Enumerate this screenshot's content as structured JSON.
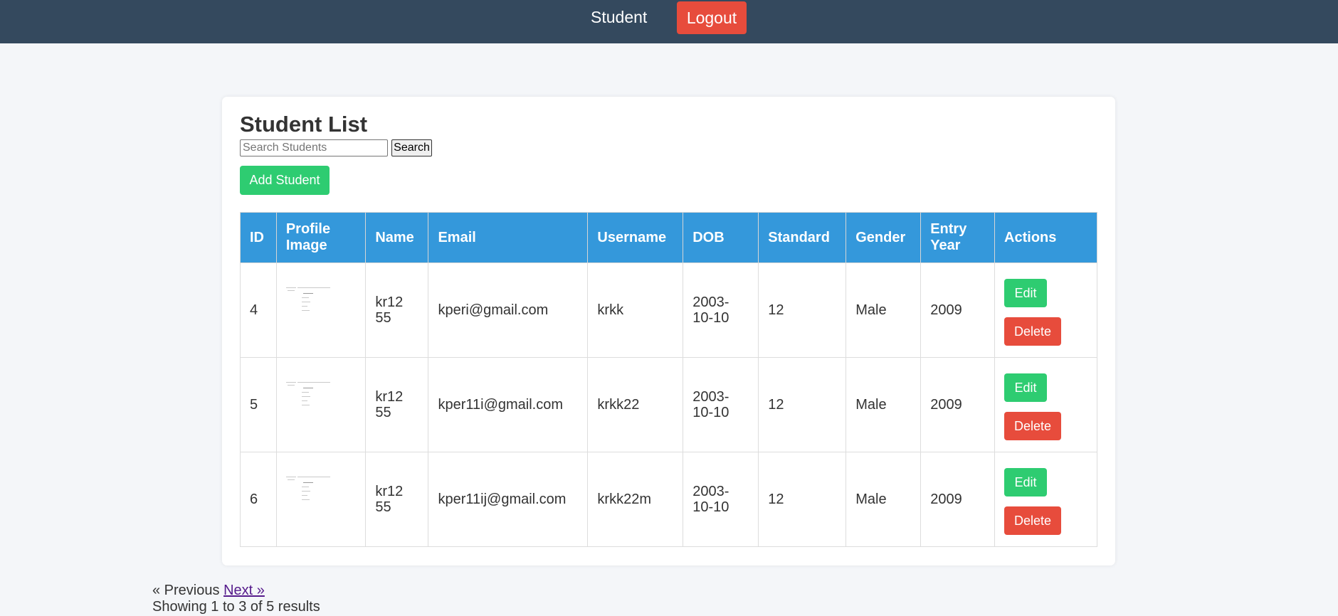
{
  "nav": {
    "student_link": "Student",
    "logout_label": "Logout"
  },
  "page": {
    "title": "Student List",
    "search_placeholder": "Search Students",
    "search_button": "Search",
    "add_button": "Add Student"
  },
  "table": {
    "headers": [
      "ID",
      "Profile Image",
      "Name",
      "Email",
      "Username",
      "DOB",
      "Standard",
      "Gender",
      "Entry Year",
      "Actions"
    ],
    "rows": [
      {
        "id": "4",
        "name": "kr12 55",
        "email": "kperi@gmail.com",
        "username": "krkk",
        "dob": "2003-10-10",
        "standard": "12",
        "gender": "Male",
        "entry_year": "2009",
        "edit": "Edit",
        "delete": "Delete"
      },
      {
        "id": "5",
        "name": "kr12 55",
        "email": "kper11i@gmail.com",
        "username": "krkk22",
        "dob": "2003-10-10",
        "standard": "12",
        "gender": "Male",
        "entry_year": "2009",
        "edit": "Edit",
        "delete": "Delete"
      },
      {
        "id": "6",
        "name": "kr12 55",
        "email": "kper11ij@gmail.com",
        "username": "krkk22m",
        "dob": "2003-10-10",
        "standard": "12",
        "gender": "Male",
        "entry_year": "2009",
        "edit": "Edit",
        "delete": "Delete"
      }
    ]
  },
  "pagination": {
    "previous": "« Previous",
    "next": "Next »",
    "summary": "Showing 1 to 3 of 5 results"
  },
  "colors": {
    "topbar": "#34495e",
    "header": "#3498db",
    "success": "#2ecc71",
    "danger": "#e74c3c"
  }
}
